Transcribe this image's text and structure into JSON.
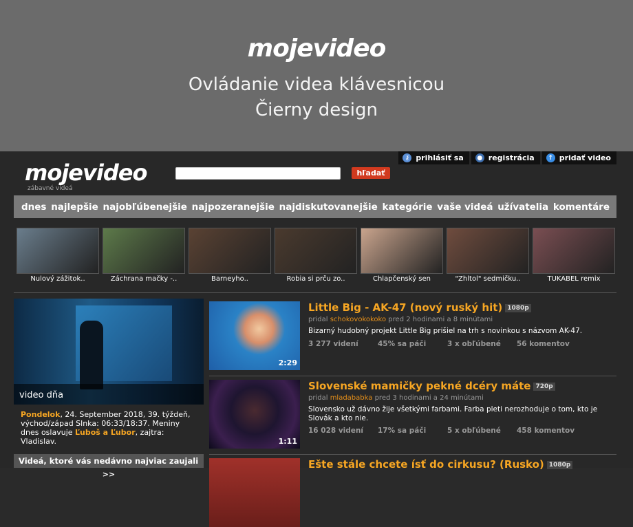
{
  "banner": {
    "logo": "mojevideo",
    "line1": "Ovládanie videa klávesnicou",
    "line2": "Čierny design"
  },
  "topbar": {
    "login": "prihlásiť sa",
    "register": "registrácia",
    "add_video": "pridať video"
  },
  "site": {
    "logo": "mojevideo",
    "tagline": "zábavné videá",
    "search_value": "",
    "search_button": "hľadať"
  },
  "nav": [
    "dnes",
    "najlepšie",
    "najobľúbenejšie",
    "najpozeranejšie",
    "najdiskutovanejšie",
    "kategórie",
    "vaše videá",
    "užívatelia",
    "komentáre"
  ],
  "thumbs": [
    {
      "caption": "Nulový zážitok..",
      "color": "#6a7d8c"
    },
    {
      "caption": "Záchrana mačky -..",
      "color": "#5d7a4a"
    },
    {
      "caption": "Barneyho..",
      "color": "#5a4233"
    },
    {
      "caption": "Robia si prču zo..",
      "color": "#4a3a2e"
    },
    {
      "caption": "Chlapčenský sen",
      "color": "#c9a48d"
    },
    {
      "caption": "\"Zhltol\" sedmičku..",
      "color": "#6f4c3e"
    },
    {
      "caption": "TUKABEL remix",
      "color": "#7a4e52"
    }
  ],
  "video_of_day": {
    "label": "video dňa",
    "day_name": "Pondelok",
    "date_text": ", 24. September 2018, 39. týždeň, východ/západ Slnka: 06:33/18:37. Meniny dnes oslavuje ",
    "names": "Ľuboš a Ľubor",
    "tomorrow": ", zajtra: Vladislav."
  },
  "recent": {
    "title": "Videá, ktoré vás nedávno najviac zaujali",
    "arrow": ">>"
  },
  "videos": [
    {
      "title": "Little Big - AK-47 (nový ruský hit)",
      "res": "1080p",
      "added": "pridal",
      "user": "schokovokokoko",
      "when": "pred 2 hodinami a 8 minútami",
      "desc": "Bizarný hudobný projekt Little Big prišiel na trh s novinkou s názvom AK-47.",
      "views": "3 277 videní",
      "likes": "45% sa páči",
      "favs": "3 x obľúbené",
      "comments": "56 komentov",
      "duration": "2:29"
    },
    {
      "title": "Slovenské mamičky pekné dcéry máte",
      "res": "720p",
      "added": "pridal",
      "user": "mladababka",
      "when": "pred 3 hodinami a 24 minútami",
      "desc": "Slovensko už dávno žije všetkými farbami. Farba pleti nerozhoduje o tom, kto je Slovák a kto nie.",
      "views": "16 028 videní",
      "likes": "17% sa páči",
      "favs": "5 x obľúbené",
      "comments": "458 komentov",
      "duration": "1:11"
    },
    {
      "title": "Ešte stále chcete ísť do cirkusu? (Rusko)",
      "res": "1080p"
    }
  ]
}
